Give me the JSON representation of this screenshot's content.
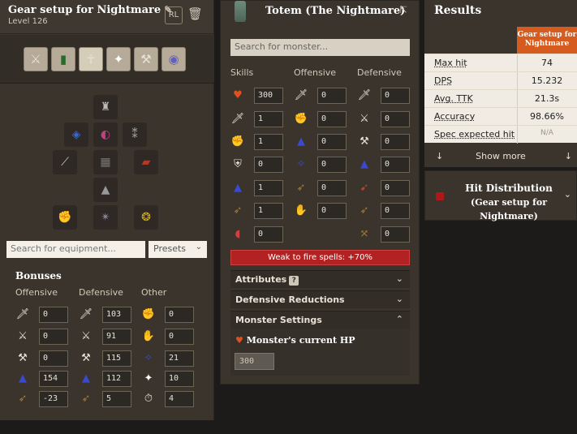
{
  "left": {
    "setup_name": "Gear setup for Nightmare",
    "level": "Level 126",
    "rl_label": "RL",
    "tabs": [
      {
        "name": "combat-styles",
        "glyph": "⚔"
      },
      {
        "name": "skills",
        "glyph": "📊"
      },
      {
        "name": "equipment",
        "glyph": "🧍"
      },
      {
        "name": "prayers",
        "glyph": "✦"
      },
      {
        "name": "buffs",
        "glyph": "🔧"
      },
      {
        "name": "spellbook",
        "glyph": "✺"
      }
    ],
    "equipment_search_placeholder": "Search for equipment...",
    "presets_label": "Presets",
    "bonuses_title": "Bonuses",
    "col_offensive": "Offensive",
    "col_defensive": "Defensive",
    "col_other": "Other",
    "offensive": [
      "0",
      "0",
      "0",
      "154",
      "-23"
    ],
    "defensive": [
      "103",
      "91",
      "115",
      "112",
      "5"
    ],
    "other": [
      "0",
      "0",
      "21",
      "10",
      "4"
    ]
  },
  "mid": {
    "title": "Totem (The Nightmare)",
    "search_placeholder": "Search for monster...",
    "col_skills": "Skills",
    "col_offensive": "Offensive",
    "col_defensive": "Defensive",
    "skills": [
      "300",
      "1",
      "1",
      "0",
      "1",
      "1",
      "0"
    ],
    "offensive": [
      "0",
      "0",
      "0",
      "0",
      "0",
      "0"
    ],
    "defensive": [
      "0",
      "0",
      "0",
      "0",
      "0",
      "0",
      "0"
    ],
    "weakness": "Weak to fire spells: +70%",
    "attributes_label": "Attributes",
    "attributes_badge": "?",
    "def_reductions_label": "Defensive Reductions",
    "monster_settings_label": "Monster Settings",
    "current_hp_label": "Monster's current HP",
    "current_hp_value": "300"
  },
  "right": {
    "results_title": "Results",
    "setup_header": "Gear setup for Nightmare",
    "rows": [
      {
        "label": "Max hit",
        "value": "74"
      },
      {
        "label": "DPS",
        "value": "15.232"
      },
      {
        "label": "Avg. TTK",
        "value": "21.3s"
      },
      {
        "label": "Accuracy",
        "value": "98.66%"
      },
      {
        "label": "Spec expected hit",
        "value": "N/A"
      }
    ],
    "show_more": "Show more",
    "hit_dist_title": "Hit Distribution",
    "hit_dist_sub": "(Gear setup for Nightmare)"
  },
  "colors": {
    "accent_orange": "#d55b1e",
    "weakness_red": "#b22222",
    "panel_bg": "#3a342c"
  }
}
